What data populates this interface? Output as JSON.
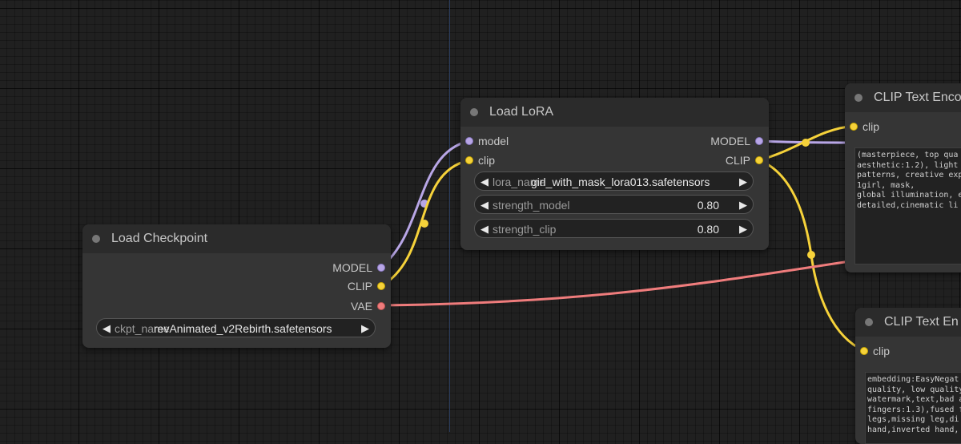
{
  "colors": {
    "canvas_bg": "#202020",
    "node_bg": "#353535",
    "node_title_bg": "#2b2b2b",
    "model_wire": "#b8a6e6",
    "clip_wire": "#f6d23a",
    "vae_wire": "#ef7c7c"
  },
  "load_checkpoint": {
    "title": "Load Checkpoint",
    "outputs": {
      "model": "MODEL",
      "clip": "CLIP",
      "vae": "VAE"
    },
    "widget": {
      "name": "ckpt_name",
      "value": "revAnimated_v2Rebirth.safetensors"
    }
  },
  "load_lora": {
    "title": "Load LoRA",
    "inputs": {
      "model": "model",
      "clip": "clip"
    },
    "outputs": {
      "model": "MODEL",
      "clip": "CLIP"
    },
    "widgets": {
      "lora_name": {
        "name": "lora_name",
        "value": "girl_with_mask_lora013.safetensors"
      },
      "strength_model": {
        "name": "strength_model",
        "value": "0.80"
      },
      "strength_clip": {
        "name": "strength_clip",
        "value": "0.80"
      }
    }
  },
  "clip_text_encode_positive": {
    "title": "CLIP Text Enco",
    "inputs": {
      "clip": "clip"
    },
    "text": "(masterpiece, top qua\naesthetic:1.2), light\npatterns, creative exp\n1girl, mask,\nglobal illumination, e\ndetailed,cinematic li"
  },
  "clip_text_encode_negative": {
    "title": "CLIP Text En",
    "inputs": {
      "clip": "clip"
    },
    "text": "embedding:EasyNegat\nquality, low quality\nwatermark,text,bad a\nfingers:1.3),fused f\nlegs,missing leg,di\nhand,inverted hand,"
  }
}
